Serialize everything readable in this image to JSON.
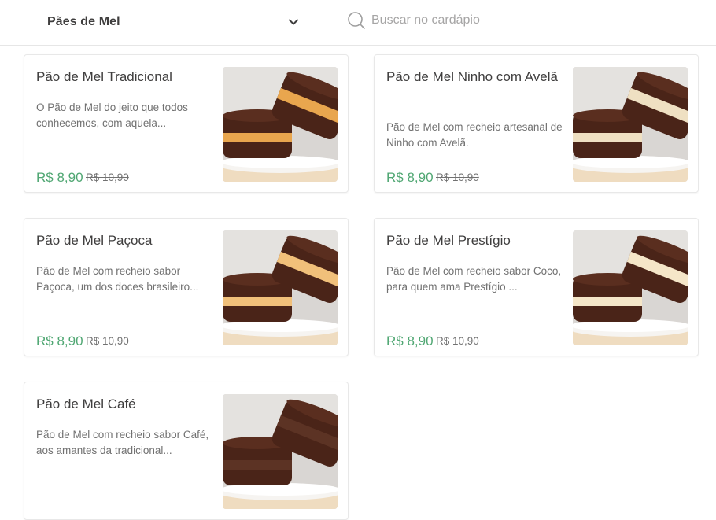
{
  "header": {
    "category": "Pães de Mel",
    "search_placeholder": "Buscar no cardápio"
  },
  "products": [
    {
      "title": "Pão de Mel Tradicional",
      "description": "O Pão de Mel do jeito que todos conhecemos, com aquela...",
      "price": "R$ 8,90",
      "old_price": "R$ 10,90",
      "filling_color": "#e9a64e"
    },
    {
      "title": "Pão de Mel Ninho com Avelã",
      "description": "Pão de Mel com recheio artesanal de Ninho com Avelã.",
      "price": "R$ 8,90",
      "old_price": "R$ 10,90",
      "filling_color": "#efe0c2"
    },
    {
      "title": "Pão de Mel Paçoca",
      "description": "Pão de Mel com recheio sabor Paçoca, um dos doces brasileiro...",
      "price": "R$ 8,90",
      "old_price": "R$ 10,90",
      "filling_color": "#f1c07a"
    },
    {
      "title": "Pão de Mel Prestígio",
      "description": "Pão de Mel com recheio sabor Coco, para quem ama Prestígio ...",
      "price": "R$ 8,90",
      "old_price": "R$ 10,90",
      "filling_color": "#f5e6c8"
    },
    {
      "title": "Pão de Mel Café",
      "description": "Pão de Mel com recheio sabor Café, aos amantes da tradicional...",
      "price": "",
      "old_price": "",
      "filling_color": "#5c3324"
    }
  ],
  "colors": {
    "price_green": "#50a773",
    "text_dark": "#3f3e3e",
    "text_muted": "#717171",
    "border": "#e8e8e8",
    "cake": "#4a2418"
  }
}
